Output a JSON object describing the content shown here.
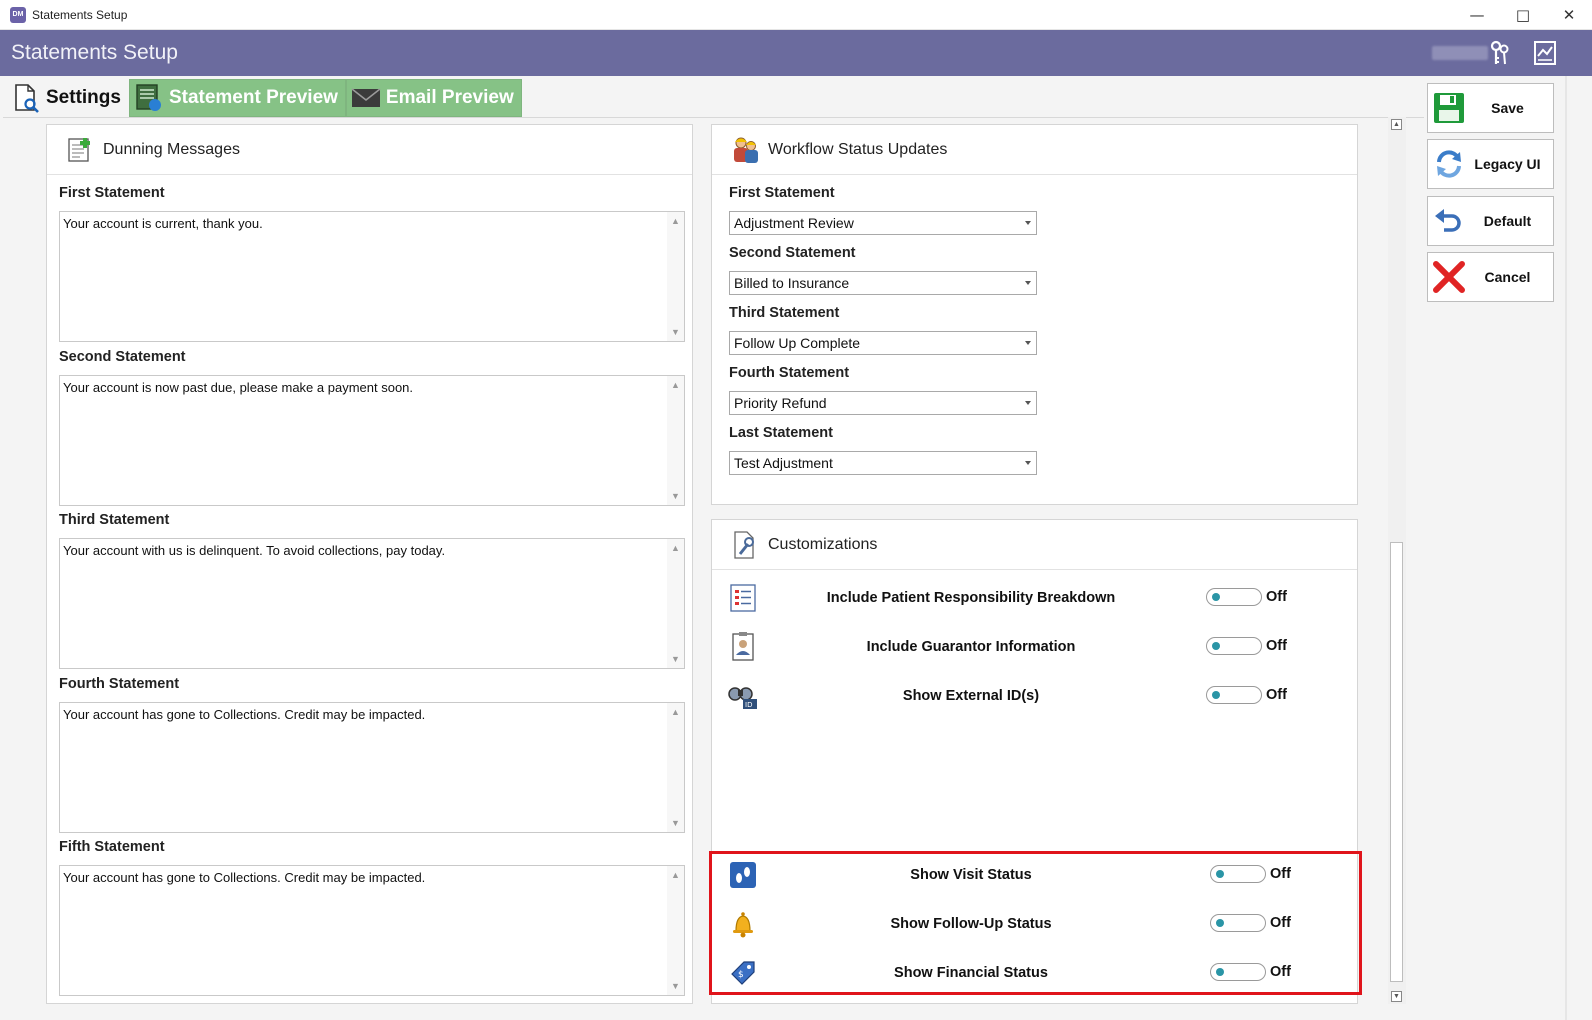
{
  "window": {
    "title": "Statements Setup",
    "app_icon_text": "DM"
  },
  "header": {
    "title": "Statements Setup"
  },
  "tabs": [
    {
      "label": "Settings"
    },
    {
      "label": "Statement Preview"
    },
    {
      "label": "Email Preview"
    }
  ],
  "dunning": {
    "title": "Dunning Messages",
    "items": [
      {
        "label": "First Statement",
        "value": "Your account is current, thank you."
      },
      {
        "label": "Second Statement",
        "value": "Your account is now past due, please make a payment soon."
      },
      {
        "label": "Third Statement",
        "value": "Your account with us is delinquent. To avoid collections, pay today."
      },
      {
        "label": "Fourth Statement",
        "value": "Your account has gone to Collections. Credit may be impacted."
      },
      {
        "label": "Fifth Statement",
        "value": "Your account has gone to Collections. Credit may be impacted."
      }
    ]
  },
  "workflow": {
    "title": "Workflow Status Updates",
    "items": [
      {
        "label": "First Statement",
        "value": "Adjustment Review"
      },
      {
        "label": "Second Statement",
        "value": "Billed to Insurance"
      },
      {
        "label": "Third Statement",
        "value": "Follow Up Complete"
      },
      {
        "label": "Fourth Statement",
        "value": "Priority Refund"
      },
      {
        "label": "Last Statement",
        "value": "Test Adjustment"
      }
    ]
  },
  "customizations": {
    "title": "Customizations",
    "items": [
      {
        "label": "Include Patient Responsibility Breakdown",
        "state": "Off",
        "icon": "list-icon"
      },
      {
        "label": "Include Guarantor Information",
        "state": "Off",
        "icon": "id-card-icon"
      },
      {
        "label": "Show External ID(s)",
        "state": "Off",
        "icon": "binoculars-id-icon"
      },
      {
        "label": "Show Visit Status",
        "state": "Off",
        "icon": "footprints-icon"
      },
      {
        "label": "Show Follow-Up Status",
        "state": "Off",
        "icon": "bell-icon"
      },
      {
        "label": "Show Financial Status",
        "state": "Off",
        "icon": "price-tag-icon"
      }
    ]
  },
  "actions": {
    "save": "Save",
    "legacy": "Legacy UI",
    "default": "Default",
    "cancel": "Cancel"
  },
  "colors": {
    "header": "#6b6b9e",
    "tab_inactive": "#86c286",
    "toggle_knob": "#2a95a6",
    "highlight": "#e0141b"
  }
}
